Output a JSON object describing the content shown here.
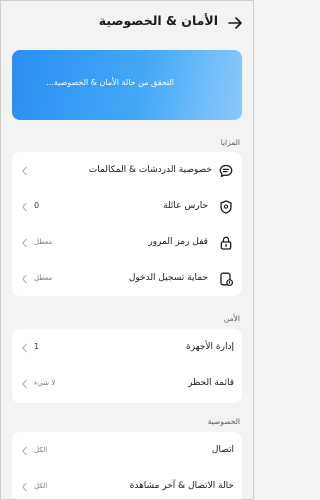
{
  "header": {
    "title": "الأمان & الخصوصية"
  },
  "banner": {
    "text": "التحقق من حالة الأمان & الخصوصية..."
  },
  "sections": {
    "features": {
      "label": "المزايا",
      "items": [
        {
          "label": "خصوصية الدردشات & المكالمات",
          "value": ""
        },
        {
          "label": "حارس عائلة",
          "value": "0"
        },
        {
          "label": "قفل رمز المرور",
          "value": "معطل"
        },
        {
          "label": "حماية تسجيل الدخول",
          "value": "معطل"
        }
      ]
    },
    "security": {
      "label": "الأمن",
      "items": [
        {
          "label": "إدارة الأجهزة",
          "value": "1"
        },
        {
          "label": "قائمة الحظر",
          "value": "لا شيء"
        }
      ]
    },
    "privacy": {
      "label": "الخصوصية",
      "items": [
        {
          "label": "اتصال",
          "value": "الكل"
        },
        {
          "label": "حالة الاتصال & آخر مشاهدة",
          "value": "الكل"
        }
      ]
    }
  },
  "colors": {
    "accent": "#2a8ff2",
    "background": "#f3f3f4",
    "card": "#ffffff"
  }
}
